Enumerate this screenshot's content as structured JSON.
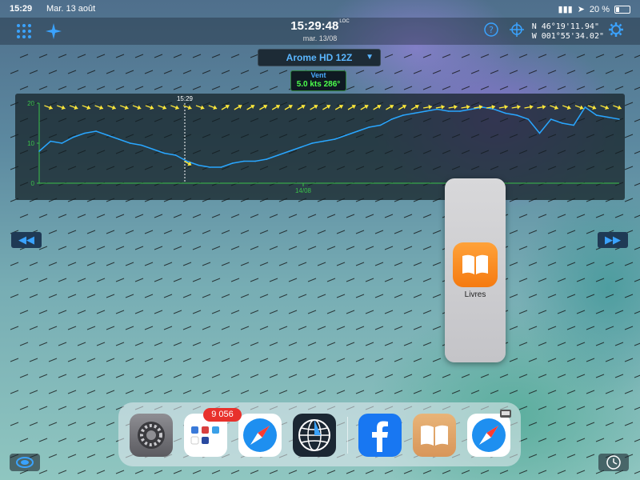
{
  "status_bar": {
    "time": "15:29",
    "date": "Mar. 13 août",
    "battery": "20 %"
  },
  "toolbar": {
    "time": "15:29:48",
    "time_suffix": "LOC",
    "date": "mar. 13/08",
    "lat": "N  46°19'11.94\"",
    "lon": "W 001°55'34.02\""
  },
  "model_selector": {
    "label": "Arome HD 12Z"
  },
  "wind_label": {
    "title": "Vent",
    "value": "5.0 kts 286°"
  },
  "chart": {
    "cursor_time": "15:29",
    "date_label": "14/08"
  },
  "chart_data": {
    "type": "line",
    "title": "",
    "xlabel": "",
    "ylabel": "",
    "ylim": [
      0,
      20
    ],
    "yticks": [
      "20",
      "10",
      "0"
    ],
    "series": [
      {
        "values": [
          8,
          10.5,
          10,
          11.5,
          12.5,
          13,
          12,
          11,
          10,
          9.5,
          8.5,
          7.5,
          7,
          5.5,
          4.5,
          4,
          4,
          5,
          5.5,
          5.5,
          6,
          7,
          8,
          9,
          10,
          10.5,
          11,
          12,
          13,
          14,
          14.5,
          16,
          17,
          17.5,
          18,
          18.5,
          18,
          18,
          18.5,
          19,
          18.5,
          17.5,
          17,
          16,
          12.5,
          16,
          15,
          14.5,
          19,
          17,
          16.5,
          16
        ]
      }
    ]
  },
  "slideover": {
    "app_label": "Livres"
  },
  "dock": {
    "badge": "9 056",
    "apps": [
      "settings-app",
      "files-app",
      "safari-app",
      "globe-app",
      "facebook-app",
      "books-app",
      "safari-app-2"
    ]
  },
  "colors": {
    "accent": "#3aa3ff",
    "line": "#29a6ff",
    "wind_value": "#4cff4c",
    "books": "#f57a10"
  }
}
